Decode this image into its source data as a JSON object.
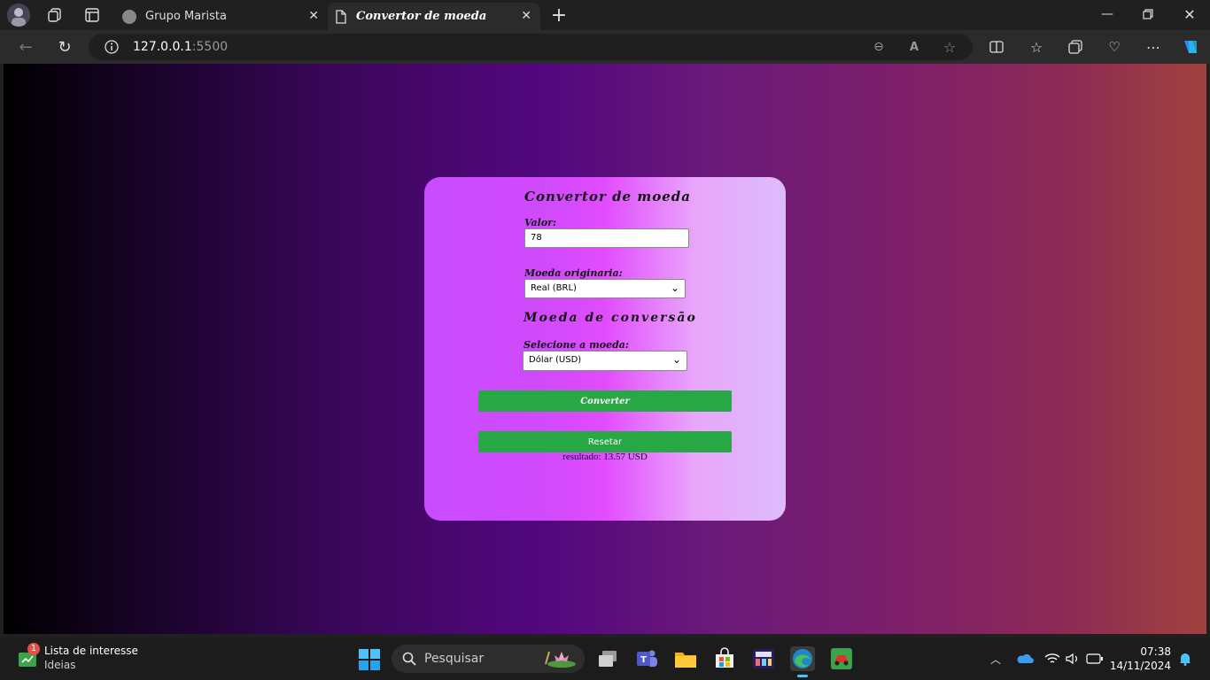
{
  "browser": {
    "tabs": [
      {
        "label": "Grupo Marista",
        "active": false
      },
      {
        "label": "Convertor de moeda",
        "active": true
      }
    ],
    "url_host": "127.0.0.1",
    "url_port": ":5500"
  },
  "page": {
    "heading": "Convertor de moeda",
    "valor_label": "Valor:",
    "valor_value": "78",
    "moeda_originaria_label": "Moeda originaria:",
    "moeda_originaria_selected": "Real (BRL)",
    "subheading": "Moeda de conversão",
    "selecione_label": "Selecione a moeda:",
    "selecione_selected": "Dólar (USD)",
    "convert_button": "Converter",
    "reset_button": "Resetar",
    "result": "resultado: 13.57 USD"
  },
  "taskbar": {
    "widget_title": "Lista de interesse",
    "widget_subtitle": "Ideias",
    "widget_badge": "1",
    "search_placeholder": "Pesquisar",
    "time": "07:38",
    "date": "14/11/2024"
  },
  "colors": {
    "button_green": "#28a745",
    "accent_blue": "#4cc2ff"
  }
}
